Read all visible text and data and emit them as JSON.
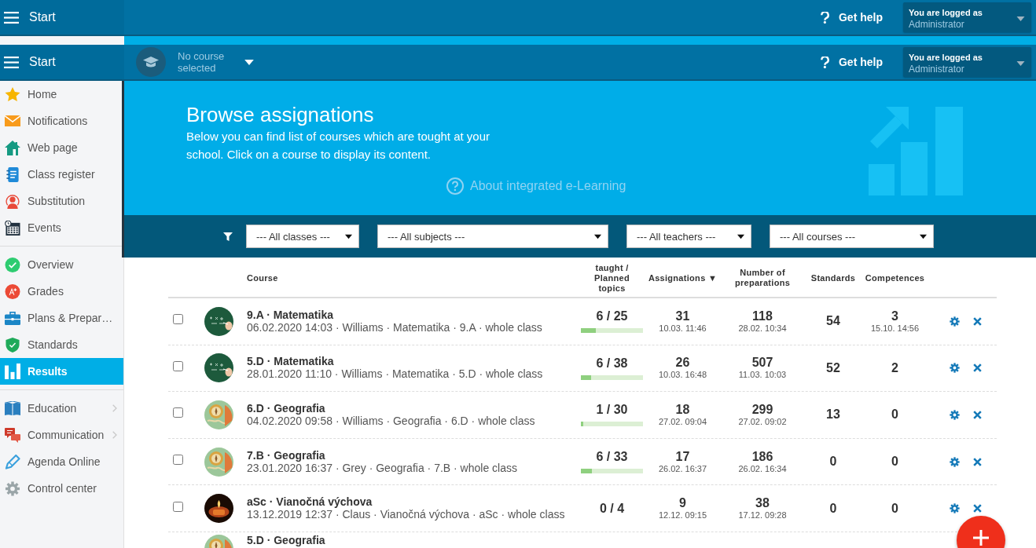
{
  "header_bars": [
    {
      "menu": {
        "label": "Start"
      },
      "help": {
        "label": "Get help"
      },
      "account": {
        "caption": "You are logged as",
        "user": "Administrator"
      }
    },
    {
      "menu": {
        "label": "Start"
      },
      "course_picker": {
        "label": "No course selected"
      },
      "help": {
        "label": "Get help"
      },
      "account": {
        "caption": "You are logged as",
        "user": "Administrator"
      }
    }
  ],
  "sidebar": {
    "groups": [
      [
        {
          "label": "Home",
          "selected": false,
          "has_submenu": false
        },
        {
          "label": "Notifications",
          "selected": false,
          "has_submenu": false
        },
        {
          "label": "Web page",
          "selected": false,
          "has_submenu": false
        },
        {
          "label": "Class register",
          "selected": false,
          "has_submenu": false
        },
        {
          "label": "Substitution",
          "selected": false,
          "has_submenu": false
        },
        {
          "label": "Events",
          "selected": false,
          "has_submenu": false
        }
      ],
      [
        {
          "label": "Overview",
          "selected": false,
          "has_submenu": false
        },
        {
          "label": "Grades",
          "selected": false,
          "has_submenu": false
        },
        {
          "label": "Plans & Prepar…",
          "selected": false,
          "has_submenu": false
        },
        {
          "label": "Standards",
          "selected": false,
          "has_submenu": false
        },
        {
          "label": "Results",
          "selected": true,
          "has_submenu": false
        }
      ],
      [
        {
          "label": "Education",
          "selected": false,
          "has_submenu": true
        },
        {
          "label": "Communication",
          "selected": false,
          "has_submenu": true
        },
        {
          "label": "Agenda Online",
          "selected": false,
          "has_submenu": false
        },
        {
          "label": "Control center",
          "selected": false,
          "has_submenu": false
        }
      ]
    ]
  },
  "banner": {
    "title": "Browse assignations",
    "description": "Below you can find list of courses which are tought at your school. Click on a course to display its content.",
    "link": "About integrated e-Learning"
  },
  "filters": [
    {
      "value": "--- All classes ---"
    },
    {
      "value": "--- All subjects ---"
    },
    {
      "value": "--- All teachers ---"
    },
    {
      "value": "--- All courses ---"
    }
  ],
  "table": {
    "columns": [
      {
        "label": "Course"
      },
      {
        "label": "taught / Planned topics"
      },
      {
        "label": "Assignations",
        "sort_mark": "▼"
      },
      {
        "label": "Number of preparations"
      },
      {
        "label": "Standards"
      },
      {
        "label": "Competences"
      }
    ],
    "rows": [
      {
        "checked": false,
        "photo": {
          "kind": "blackboard"
        },
        "title": "9.A · Matematika",
        "details": "06.02.2020 14:03 · Williams · Matematika · 9.A · whole class",
        "topics": "6 / 25",
        "level": 0.24,
        "assignations": {
          "count": "31",
          "date": "10.03. 11:46"
        },
        "preparations": {
          "count": "118",
          "date": "28.02. 10:34"
        },
        "standards": "54",
        "competences": {
          "count": "3",
          "date": "15.10. 14:56"
        }
      },
      {
        "checked": false,
        "photo": {
          "kind": "blackboard"
        },
        "title": "5.D · Matematika",
        "details": "28.01.2020 11:10 · Williams · Matematika · 5.D · whole class",
        "topics": "6 / 38",
        "level": 0.16,
        "assignations": {
          "count": "26",
          "date": "10.03. 16:48"
        },
        "preparations": {
          "count": "507",
          "date": "11.03. 10:03"
        },
        "standards": "52",
        "competences": {
          "count": "2"
        }
      },
      {
        "checked": false,
        "photo": {
          "kind": "map"
        },
        "title": "6.D · Geografia",
        "details": "04.02.2020 09:58 · Williams · Geografia · 6.D · whole class",
        "topics": "1 / 30",
        "level": 0.033,
        "assignations": {
          "count": "18",
          "date": "27.02. 09:04"
        },
        "preparations": {
          "count": "299",
          "date": "27.02. 09:02"
        },
        "standards": "13",
        "competences": {
          "count": "0"
        }
      },
      {
        "checked": false,
        "photo": {
          "kind": "map"
        },
        "title": "7.B · Geografia",
        "details": "23.01.2020 16:37 · Grey · Geografia · 7.B · whole class",
        "topics": "6 / 33",
        "level": 0.18,
        "assignations": {
          "count": "17",
          "date": "26.02. 16:37"
        },
        "preparations": {
          "count": "186",
          "date": "26.02. 16:34"
        },
        "standards": "0",
        "competences": {
          "count": "0"
        }
      },
      {
        "checked": false,
        "photo": {
          "kind": "candle"
        },
        "title": "aSc · Vianočná výchova",
        "details": "13.12.2019 12:37 · Claus · Vianočná výchova · aSc · whole class",
        "topics": "0 / 4",
        "assignations": {
          "count": "9",
          "date": "12.12. 09:15"
        },
        "preparations": {
          "count": "38",
          "date": "17.12. 09:28"
        },
        "standards": "0",
        "competences": {
          "count": "0"
        }
      },
      {
        "photo": {
          "kind": "map"
        },
        "title": "5.D · Geografia"
      }
    ]
  }
}
